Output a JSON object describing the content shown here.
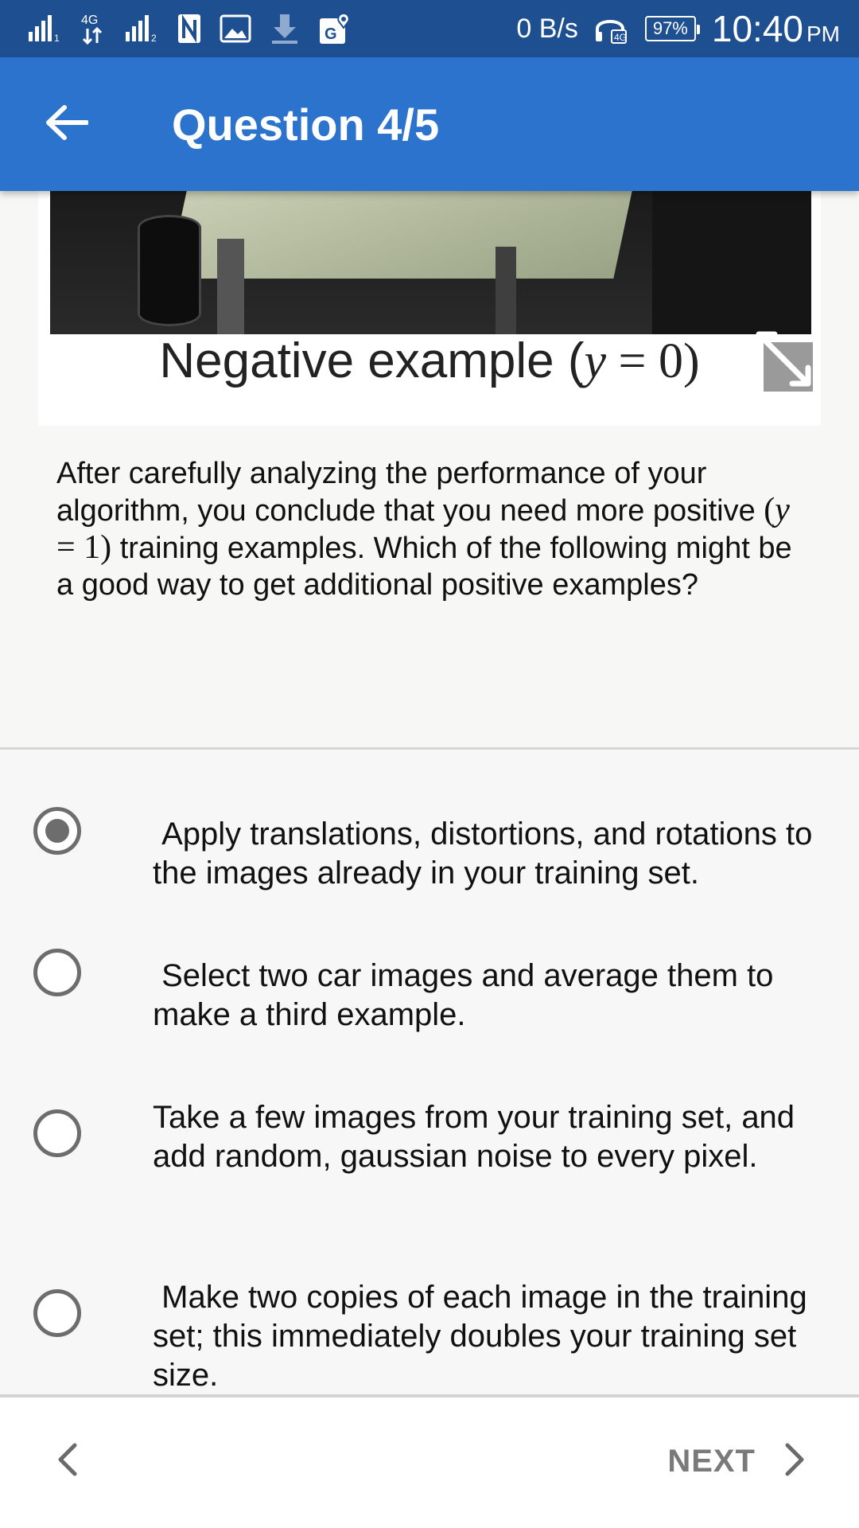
{
  "status_bar": {
    "network_label": "4G",
    "speed": "0 B/s",
    "battery": "97%",
    "time": "10:40",
    "ampm": "PM",
    "icons": [
      "signal-icon",
      "network-4g-icon",
      "signal-icon",
      "n-notification-icon",
      "image-icon",
      "download-icon",
      "maps-icon",
      "headset-icon",
      "battery-icon"
    ]
  },
  "app_bar": {
    "title": "Question 4/5",
    "back_icon": "arrow-left-icon"
  },
  "figure": {
    "caption_prefix": "Negative example (",
    "caption_var": "y",
    "caption_eq": " = 0)",
    "expand_icon": "expand-icon"
  },
  "question": {
    "part1": "After carefully analyzing the performance of your algorithm, you conclude that you need more positive ",
    "math_open": "(",
    "math_var": "y",
    "math_rest": " = 1)",
    "part2": " training examples. Which of the following might be a good way to get additional positive examples?"
  },
  "options": [
    {
      "label": " Apply translations, distortions, and rotations to the images already in your training set.",
      "selected": true
    },
    {
      "label": " Select two car images and average them to make a third example.",
      "selected": false
    },
    {
      "label": "Take a few images from your training set, and add random, gaussian noise to every pixel.",
      "selected": false
    },
    {
      "label": " Make two copies of each image in the training set; this immediately doubles your training set size.",
      "selected": false
    }
  ],
  "bottom_nav": {
    "prev_icon": "chevron-left-icon",
    "next_label": "NEXT",
    "next_icon": "chevron-right-icon"
  },
  "colors": {
    "status_bar": "#1d4f91",
    "app_bar": "#2b73cc",
    "radio": "#6d6d6d",
    "next_text": "#7a7a7a"
  }
}
